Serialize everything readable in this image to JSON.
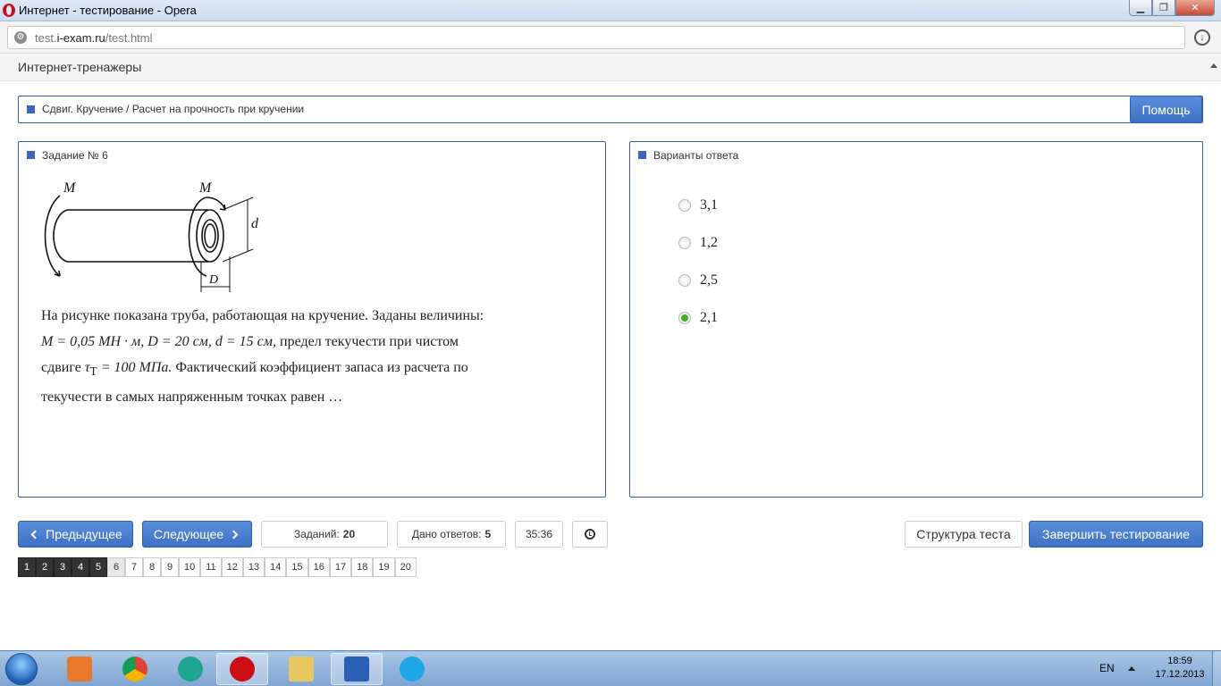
{
  "window": {
    "title": "Интернет - тестирование - Opera"
  },
  "address": {
    "url_prefix": "test.",
    "url_domain": "i-exam.ru",
    "url_path": "/test.html"
  },
  "site": {
    "brand": "Интернет-тренажеры"
  },
  "topic": {
    "title": "Сдвиг. Кручение / Расчет на прочность при кручении",
    "help_label": "Помощь"
  },
  "task": {
    "title": "Задание № 6",
    "figure_labels": {
      "m_left": "M",
      "m_right": "M",
      "d_small": "d",
      "d_big": "D"
    },
    "line1": "На рисунке показана труба, работающая на кручение. Заданы величины:",
    "line2_math": "M = 0,05 МН · м, D = 20 см, d = 15 см,",
    "line2_text": "предел текучести при чистом",
    "line3_text_a": "сдвиге",
    "line3_math": "τ",
    "line3_sub": "Т",
    "line3_math2": "= 100 МПа.",
    "line3_text_b": "Фактический коэффициент запаса из расчета по",
    "line4": "текучести в самых напряженным точках равен …"
  },
  "answers": {
    "title": "Варианты ответа",
    "options": [
      {
        "label": "3,1",
        "checked": false
      },
      {
        "label": "1,2",
        "checked": false
      },
      {
        "label": "2,5",
        "checked": false
      },
      {
        "label": "2,1",
        "checked": true
      }
    ]
  },
  "toolbar": {
    "prev_label": "Предыдущее",
    "next_label": "Следующее",
    "tasks_label": "Заданий:",
    "tasks_count": "20",
    "answered_label": "Дано ответов:",
    "answered_count": "5",
    "timer": "35:36",
    "structure_label": "Структура теста",
    "finish_label": "Завершить тестирование"
  },
  "pager": {
    "pages": [
      "1",
      "2",
      "3",
      "4",
      "5",
      "6",
      "7",
      "8",
      "9",
      "10",
      "11",
      "12",
      "13",
      "14",
      "15",
      "16",
      "17",
      "18",
      "19",
      "20"
    ],
    "answered": 5,
    "current": 6
  },
  "taskbar": {
    "lang": "EN",
    "time": "18:59",
    "date": "17.12.2013"
  },
  "colors": {
    "accent": "#3e70c4",
    "panel_border": "#3e5ea8",
    "checked": "#3cb021"
  }
}
